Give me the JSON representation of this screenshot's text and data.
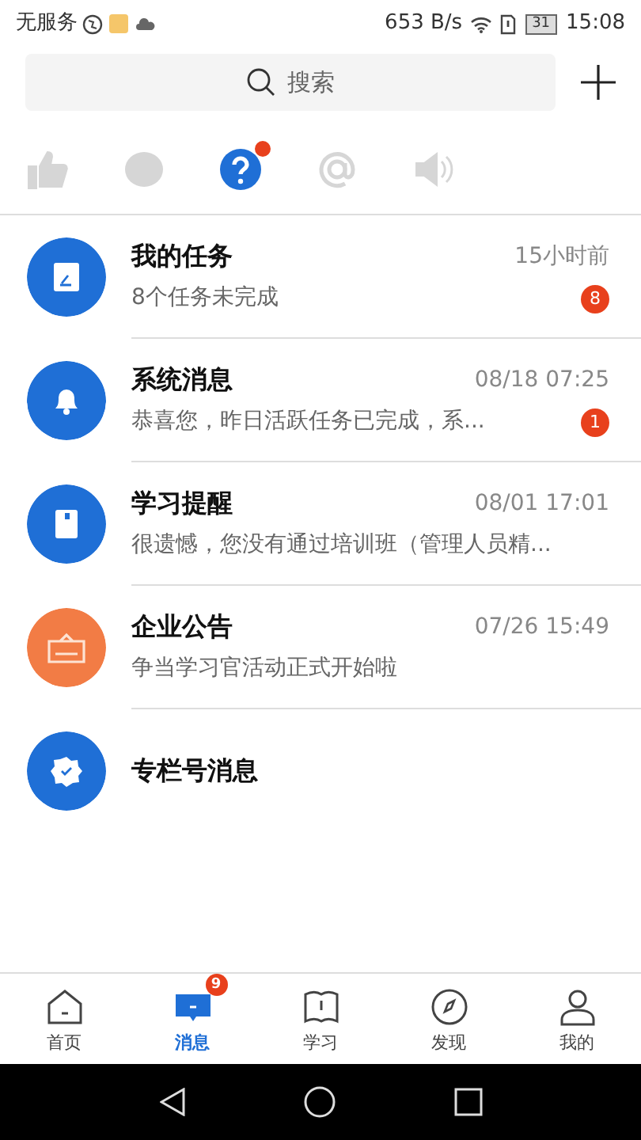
{
  "status_bar": {
    "carrier": "无服务",
    "speed": "653 B/s",
    "battery": "31",
    "time": "15:08"
  },
  "search": {
    "placeholder": "搜索"
  },
  "filters": [
    {
      "kind": "like",
      "selected": false,
      "dot": false
    },
    {
      "kind": "comment",
      "selected": false,
      "dot": false
    },
    {
      "kind": "question",
      "selected": true,
      "dot": true
    },
    {
      "kind": "at",
      "selected": false,
      "dot": false
    },
    {
      "kind": "speaker",
      "selected": false,
      "dot": false
    }
  ],
  "messages": [
    {
      "kind": "task",
      "title": "我的任务",
      "time": "15小时前",
      "preview": "8个任务未完成",
      "badge": "8",
      "color": "#1f6fd6"
    },
    {
      "kind": "bell",
      "title": "系统消息",
      "time": "08/18 07:25",
      "preview": "恭喜您，昨日活跃任务已完成，系...",
      "badge": "1",
      "color": "#1f6fd6"
    },
    {
      "kind": "book",
      "title": "学习提醒",
      "time": "08/01 17:01",
      "preview": "很遗憾，您没有通过培训班（管理人员精...",
      "color": "#1f6fd6"
    },
    {
      "kind": "notice",
      "title": "企业公告",
      "time": "07/26 15:49",
      "preview": "争当学习官活动正式开始啦",
      "color": "#f27c45"
    },
    {
      "kind": "badge",
      "title": "专栏号消息",
      "color": "#1f6fd6"
    }
  ],
  "tabs": [
    {
      "kind": "home",
      "label": "首页",
      "selected": false
    },
    {
      "kind": "message",
      "label": "消息",
      "selected": true,
      "badge": "9"
    },
    {
      "kind": "study",
      "label": "学习",
      "selected": false
    },
    {
      "kind": "discover",
      "label": "发现",
      "selected": false
    },
    {
      "kind": "me",
      "label": "我的",
      "selected": false
    }
  ]
}
